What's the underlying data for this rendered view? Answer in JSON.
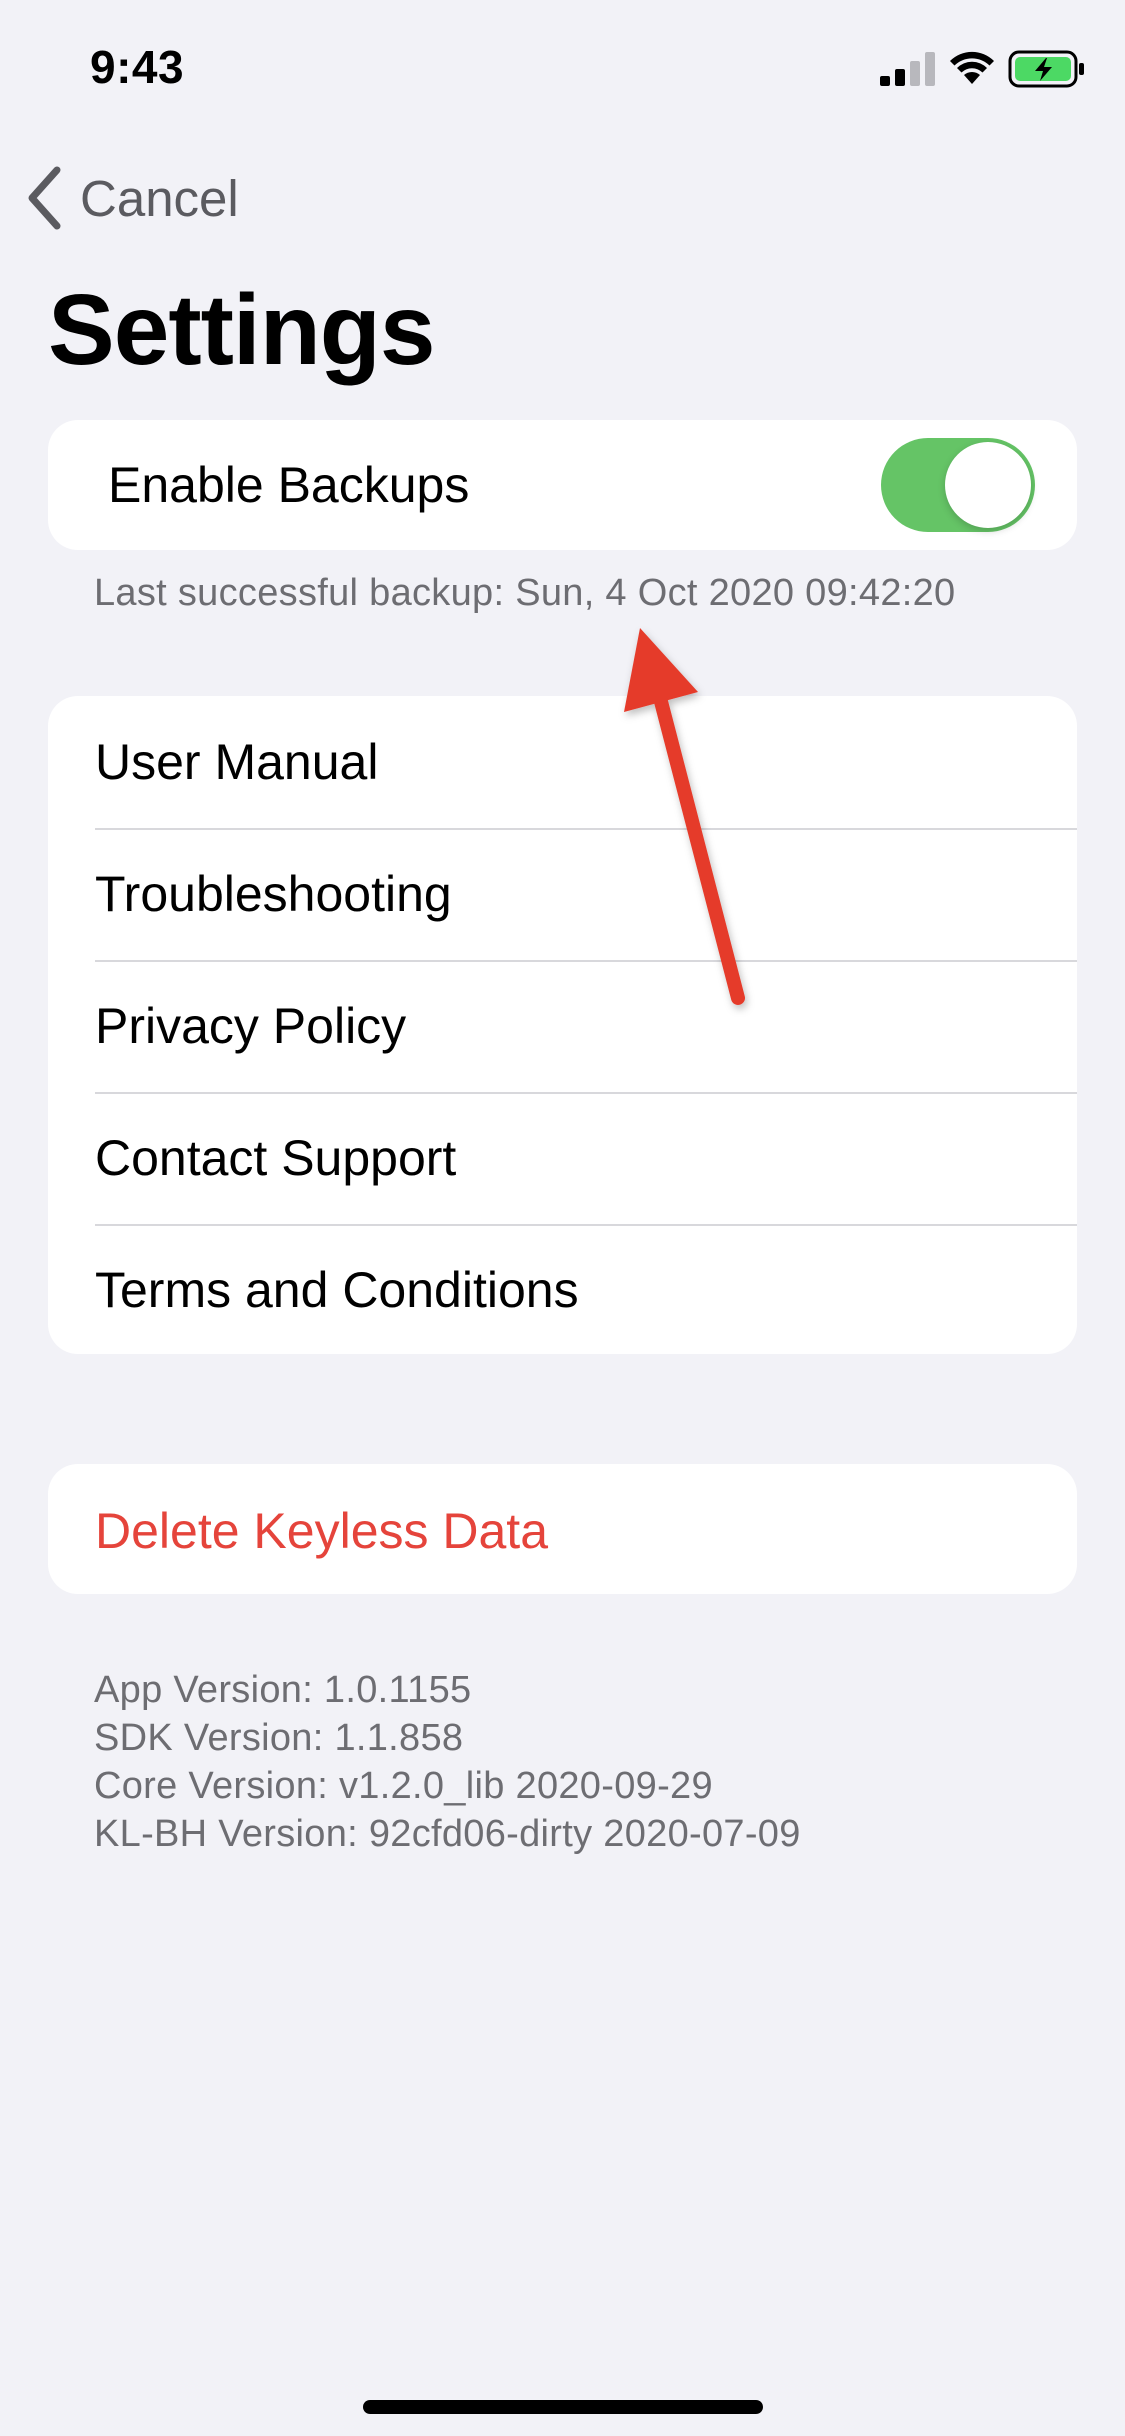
{
  "status_bar": {
    "time": "9:43",
    "icons": [
      "cellular-signal-icon",
      "wifi-icon",
      "battery-charging-icon"
    ]
  },
  "nav": {
    "back_label": "Cancel",
    "back_icon": "chevron-left-icon"
  },
  "title": "Settings",
  "backup": {
    "label": "Enable Backups",
    "enabled": true,
    "last_backup": "Last successful backup: Sun, 4 Oct 2020 09:42:20"
  },
  "menu": {
    "items": [
      {
        "label": "User Manual"
      },
      {
        "label": "Troubleshooting"
      },
      {
        "label": "Privacy Policy"
      },
      {
        "label": "Contact Support"
      },
      {
        "label": "Terms and Conditions"
      }
    ]
  },
  "danger": {
    "delete_label": "Delete Keyless Data"
  },
  "versions": {
    "app": "App Version: 1.0.1155",
    "sdk": "SDK Version: 1.1.858",
    "core": "Core Version: v1.2.0_lib 2020-09-29",
    "klbh": "KL-BH Version: 92cfd06-dirty 2020-07-09"
  },
  "colors": {
    "background": "#f2f2f7",
    "card": "#ffffff",
    "toggle_on": "#65c466",
    "destructive": "#e5443b",
    "annotation_arrow": "#e53b2a",
    "secondary_text": "#6d6d72"
  }
}
